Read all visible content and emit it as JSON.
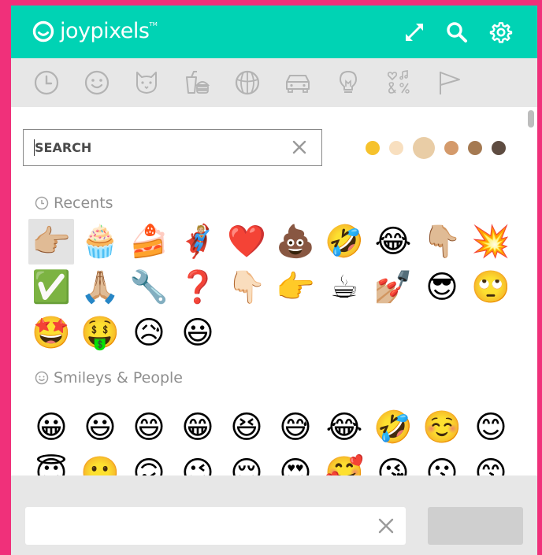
{
  "app": {
    "logo_text": "joypixels",
    "logo_tm": "TM"
  },
  "header": {
    "icons": [
      "expand-icon",
      "search-icon",
      "gear-icon"
    ]
  },
  "categories": [
    {
      "name": "recents",
      "icon": "clock-icon"
    },
    {
      "name": "smileys",
      "icon": "smiley-icon"
    },
    {
      "name": "animals",
      "icon": "cat-face-icon"
    },
    {
      "name": "food",
      "icon": "drink-burger-icon"
    },
    {
      "name": "activity",
      "icon": "basketball-icon"
    },
    {
      "name": "travel",
      "icon": "car-icon"
    },
    {
      "name": "objects",
      "icon": "lightbulb-icon"
    },
    {
      "name": "symbols",
      "icon": "symbols-icon"
    },
    {
      "name": "flags",
      "icon": "flag-icon"
    }
  ],
  "search": {
    "placeholder": "SEARCH",
    "value": ""
  },
  "tones": [
    "#f6c22c",
    "#f8dfbf",
    "#e9cda6",
    "#d49a6b",
    "#a57a52",
    "#5e4c41"
  ],
  "sections": {
    "recents": {
      "title": "Recents",
      "emojis": [
        "👉🏼",
        "🧁",
        "🍰",
        "🦸🏼",
        "❤️",
        "💩",
        "🤣",
        "😂",
        "👇🏼",
        "💥",
        "✅",
        "🙏🏼",
        "🔧",
        "❓",
        "👇🏻",
        "👉",
        "☕",
        "💅🏼",
        "😎",
        "🙄",
        "🤩",
        "🤑",
        "😥",
        "😃"
      ]
    },
    "people": {
      "title": "Smileys & People",
      "emojis": [
        "😀",
        "😃",
        "😄",
        "😁",
        "😆",
        "😅",
        "😂",
        "🤣",
        "☺️",
        "😊",
        "😇",
        "🙂",
        "🙃",
        "😉",
        "😌",
        "😍",
        "🥰",
        "😘",
        "😗",
        "😙"
      ]
    }
  },
  "footer": {
    "input_value": "",
    "button_label": ""
  }
}
